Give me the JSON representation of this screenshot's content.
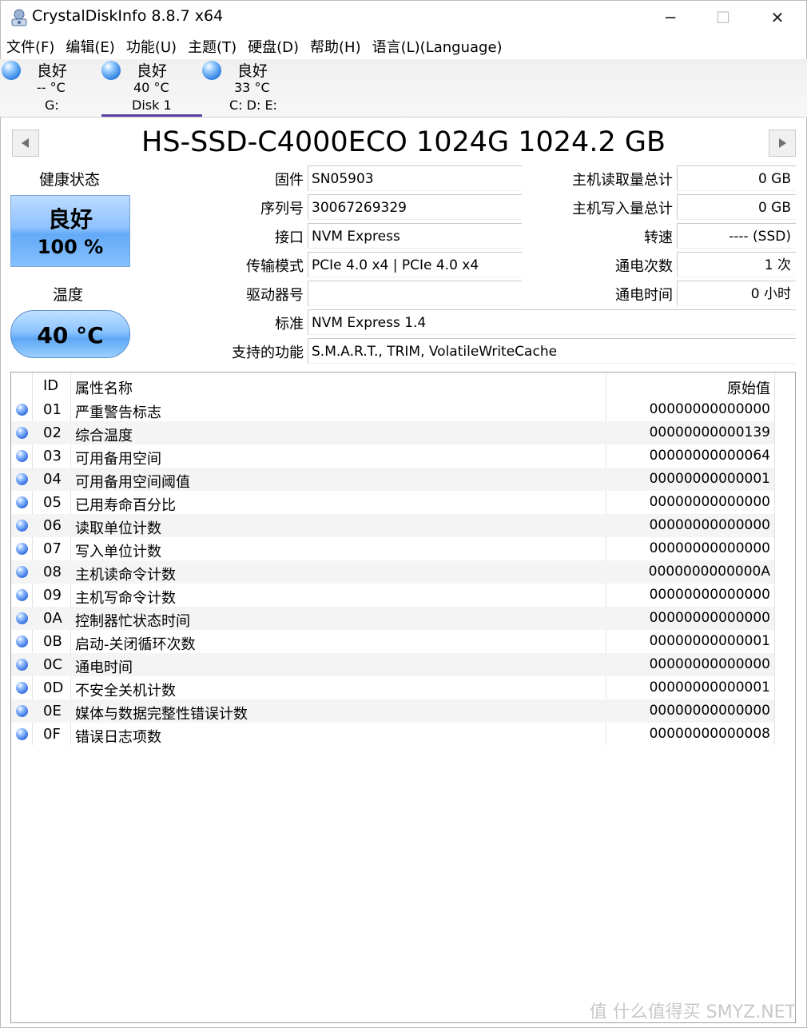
{
  "window": {
    "title": "CrystalDiskInfo 8.8.7 x64",
    "minimize": "─",
    "maximize": "☐",
    "close": "✕"
  },
  "menu": [
    "文件(F)",
    "编辑(E)",
    "功能(U)",
    "主题(T)",
    "硬盘(D)",
    "帮助(H)",
    "语言(L)(Language)"
  ],
  "disks": [
    {
      "status": "良好",
      "temp": "-- °C",
      "label": "G:"
    },
    {
      "status": "良好",
      "temp": "40 °C",
      "label": "Disk 1"
    },
    {
      "status": "良好",
      "temp": "33 °C",
      "label": "C: D: E:"
    }
  ],
  "model": "HS-SSD-C4000ECO 1024G 1024.2 GB",
  "health": {
    "label": "健康状态",
    "status": "良好",
    "percent": "100 %"
  },
  "temperature": {
    "label": "温度",
    "value": "40 °C"
  },
  "info": {
    "firmware_label": "固件",
    "firmware": "SN05903",
    "serial_label": "序列号",
    "serial": "30067269329",
    "interface_label": "接口",
    "interface": "NVM Express",
    "transfer_label": "传输模式",
    "transfer": "PCIe 4.0 x4 | PCIe 4.0 x4",
    "drive_label": "驱动器号",
    "drive": "",
    "standard_label": "标准",
    "standard": "NVM Express 1.4",
    "features_label": "支持的功能",
    "features": "S.M.A.R.T., TRIM, VolatileWriteCache",
    "host_reads_label": "主机读取量总计",
    "host_reads": "0 GB",
    "host_writes_label": "主机写入量总计",
    "host_writes": "0 GB",
    "rotation_label": "转速",
    "rotation": "---- (SSD)",
    "power_count_label": "通电次数",
    "power_count": "1 次",
    "power_hours_label": "通电时间",
    "power_hours": "0 小时"
  },
  "smart": {
    "headers": {
      "id": "ID",
      "name": "属性名称",
      "raw": "原始值"
    },
    "rows": [
      {
        "id": "01",
        "name": "严重警告标志",
        "raw": "00000000000000"
      },
      {
        "id": "02",
        "name": "综合温度",
        "raw": "00000000000139"
      },
      {
        "id": "03",
        "name": "可用备用空间",
        "raw": "00000000000064"
      },
      {
        "id": "04",
        "name": "可用备用空间阈值",
        "raw": "00000000000001"
      },
      {
        "id": "05",
        "name": "已用寿命百分比",
        "raw": "00000000000000"
      },
      {
        "id": "06",
        "name": "读取单位计数",
        "raw": "00000000000000"
      },
      {
        "id": "07",
        "name": "写入单位计数",
        "raw": "00000000000000"
      },
      {
        "id": "08",
        "name": "主机读命令计数",
        "raw": "0000000000000A"
      },
      {
        "id": "09",
        "name": "主机写命令计数",
        "raw": "00000000000000"
      },
      {
        "id": "0A",
        "name": "控制器忙状态时间",
        "raw": "00000000000000"
      },
      {
        "id": "0B",
        "name": "启动-关闭循环次数",
        "raw": "00000000000001"
      },
      {
        "id": "0C",
        "name": "通电时间",
        "raw": "00000000000000"
      },
      {
        "id": "0D",
        "name": "不安全关机计数",
        "raw": "00000000000001"
      },
      {
        "id": "0E",
        "name": "媒体与数据完整性错误计数",
        "raw": "00000000000000"
      },
      {
        "id": "0F",
        "name": "错误日志项数",
        "raw": "00000000000008"
      }
    ]
  },
  "watermark": "值 什么值得买 SMYZ.NET",
  "colors": {
    "accent": "#5c3fa3",
    "health_blue": "#63aaf7",
    "status_ball": "#2a7de0"
  }
}
